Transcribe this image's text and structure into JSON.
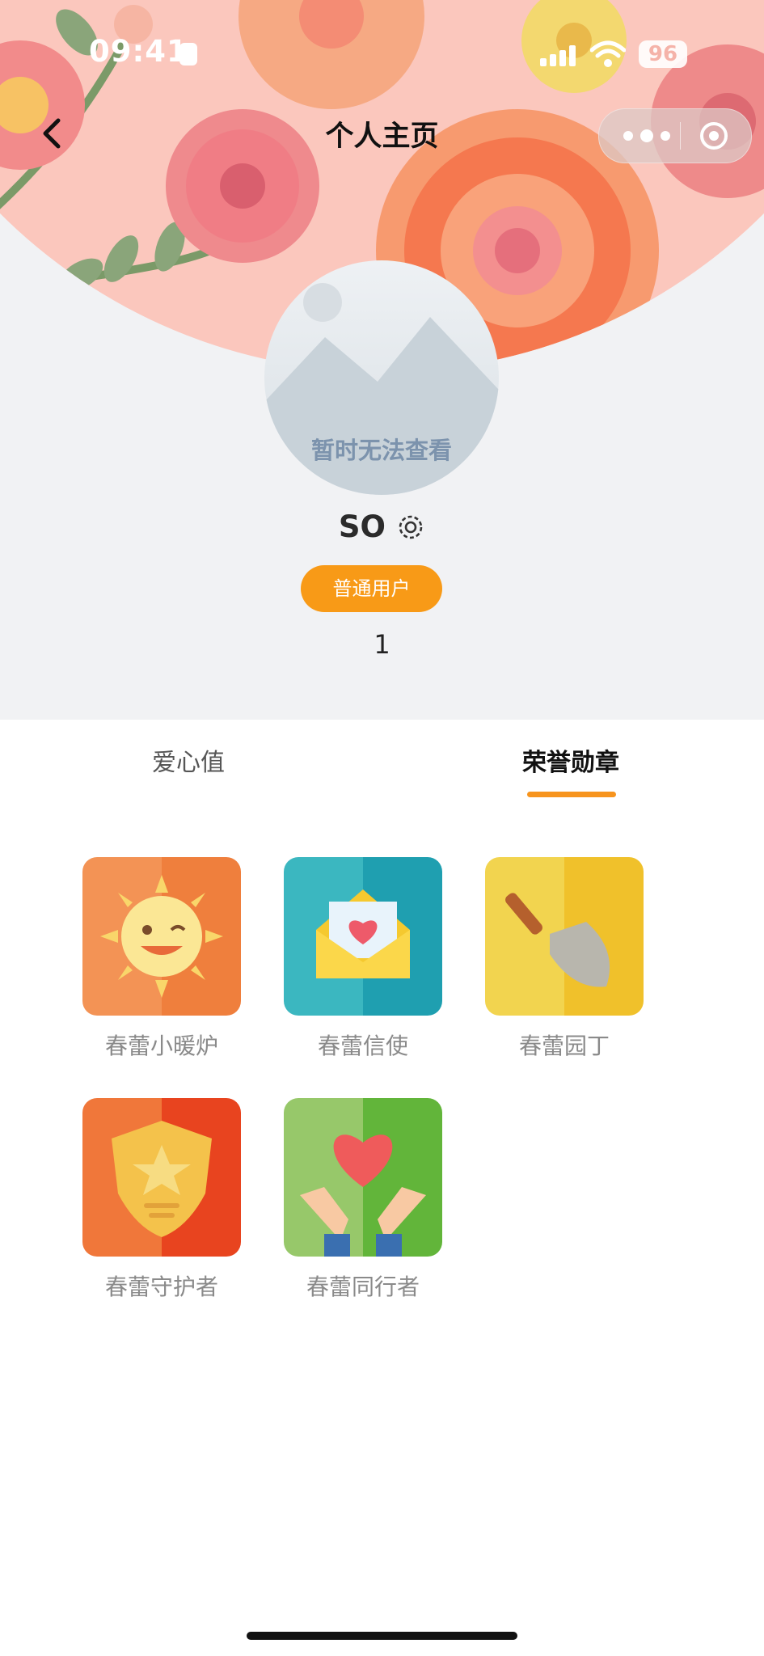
{
  "status_bar": {
    "time": "09:41",
    "battery": "96"
  },
  "nav": {
    "title": "个人主页",
    "back_icon": "chevron-left-icon",
    "more_icon": "more-dots-icon",
    "close_icon": "target-circle-icon"
  },
  "profile": {
    "avatar_placeholder": "暂时无法查看",
    "username": "SO",
    "settings_icon": "gear-icon",
    "role": "普通用户",
    "count": "1"
  },
  "tabs": [
    {
      "label": "爱心值",
      "active": false
    },
    {
      "label": "荣誉勋章",
      "active": true
    }
  ],
  "badges": [
    {
      "label": "春蕾小暖炉",
      "icon": "sun-icon"
    },
    {
      "label": "春蕾信使",
      "icon": "envelope-heart-icon"
    },
    {
      "label": "春蕾园丁",
      "icon": "shovel-icon"
    },
    {
      "label": "春蕾守护者",
      "icon": "shield-star-icon"
    },
    {
      "label": "春蕾同行者",
      "icon": "hands-heart-icon"
    }
  ],
  "colors": {
    "accent": "#f89a17",
    "header_pink": "#fbc7bd",
    "background": "#f1f2f4"
  }
}
